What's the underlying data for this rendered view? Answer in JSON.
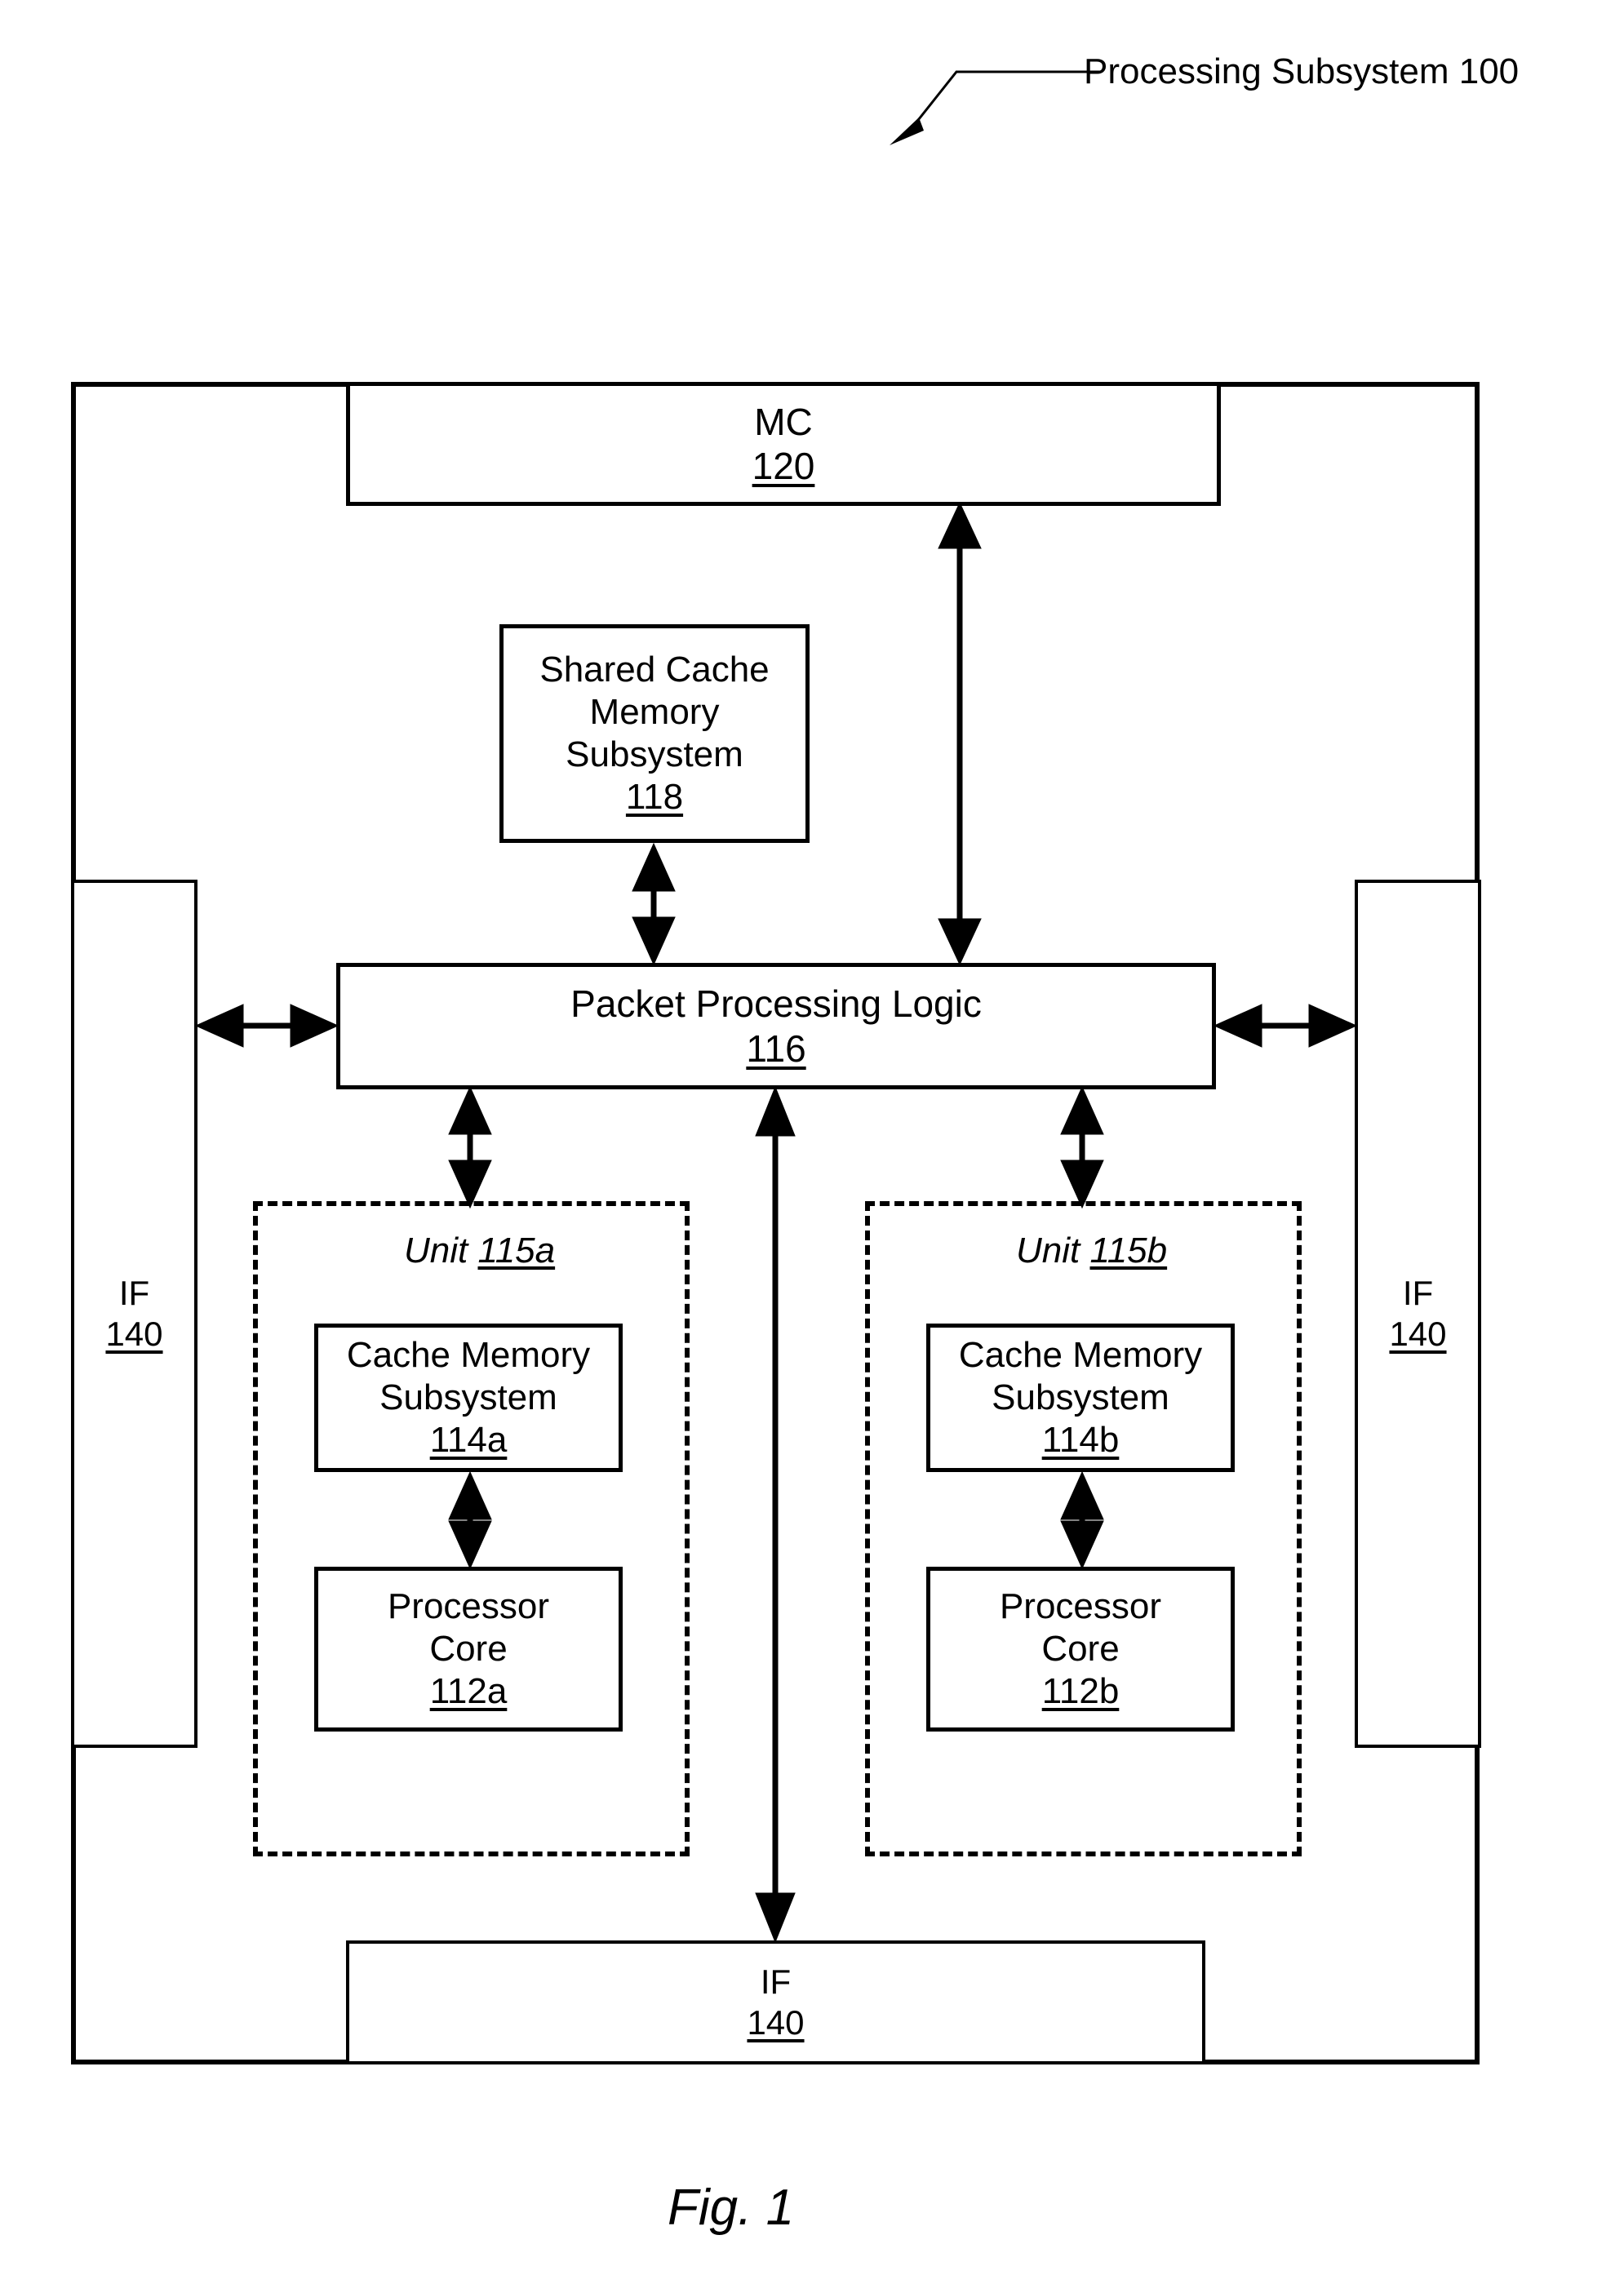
{
  "figure": {
    "caption": "Fig. 1",
    "callout_label": "Processing Subsystem 100"
  },
  "blocks": {
    "mc": {
      "label": "MC",
      "number": "120"
    },
    "shared_cache": {
      "line1": "Shared Cache",
      "line2": "Memory",
      "line3": "Subsystem",
      "number": "118"
    },
    "packet_processing_logic": {
      "label": "Packet Processing Logic",
      "number": "116"
    },
    "if_left": {
      "label": "IF",
      "number": "140"
    },
    "if_right": {
      "label": "IF",
      "number": "140"
    },
    "if_bottom": {
      "label": "IF",
      "number": "140"
    },
    "unit_a": {
      "title_word": "Unit ",
      "title_number": "115a",
      "cache": {
        "line1": "Cache Memory",
        "line2": "Subsystem",
        "number": "114a"
      },
      "core": {
        "line1": "Processor",
        "line2": "Core",
        "number": "112a"
      }
    },
    "unit_b": {
      "title_word": "Unit ",
      "title_number": "115b",
      "cache": {
        "line1": "Cache Memory",
        "line2": "Subsystem",
        "number": "114b"
      },
      "core": {
        "line1": "Processor",
        "line2": "Core",
        "number": "112b"
      }
    }
  },
  "colors": {
    "stroke": "#000000",
    "background": "#ffffff"
  }
}
